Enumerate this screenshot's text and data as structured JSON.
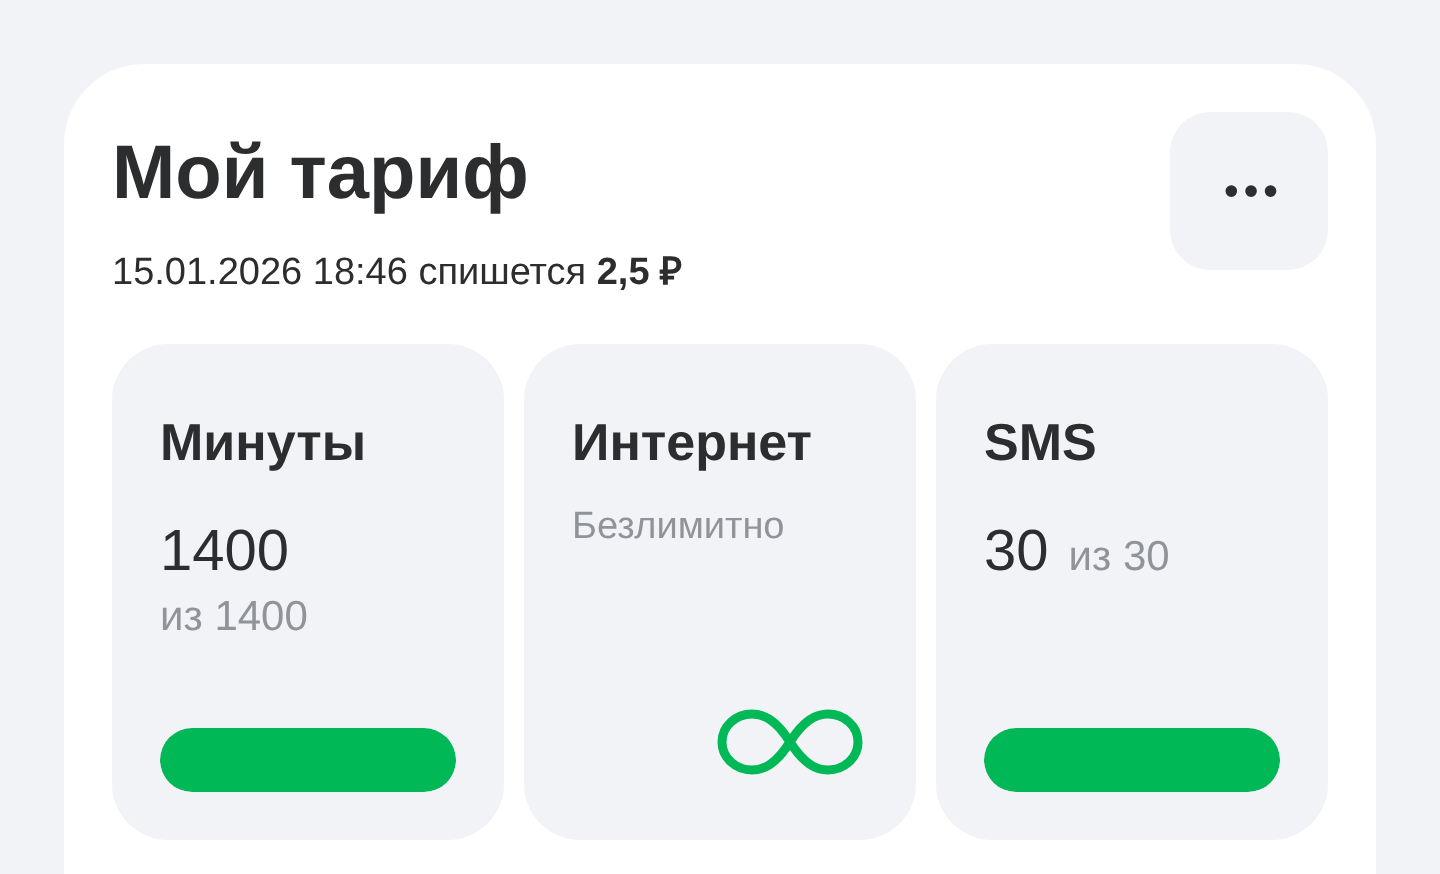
{
  "title": "Мой тариф",
  "subtitle": "15.01.2026 18:46 спишется **2,5 ₽**",
  "more_button": {
    "label": "•••"
  },
  "tiles": [
    {
      "kind": "counter",
      "title": "Минуты",
      "value": "1400",
      "total": "из 1400",
      "level": 1
    },
    {
      "kind": "unlimited",
      "title": "Интернет",
      "note": "Безлимитно"
    },
    {
      "kind": "counter_inline",
      "title": "SMS",
      "value": "30",
      "total": "из 30",
      "level": 1
    }
  ]
}
